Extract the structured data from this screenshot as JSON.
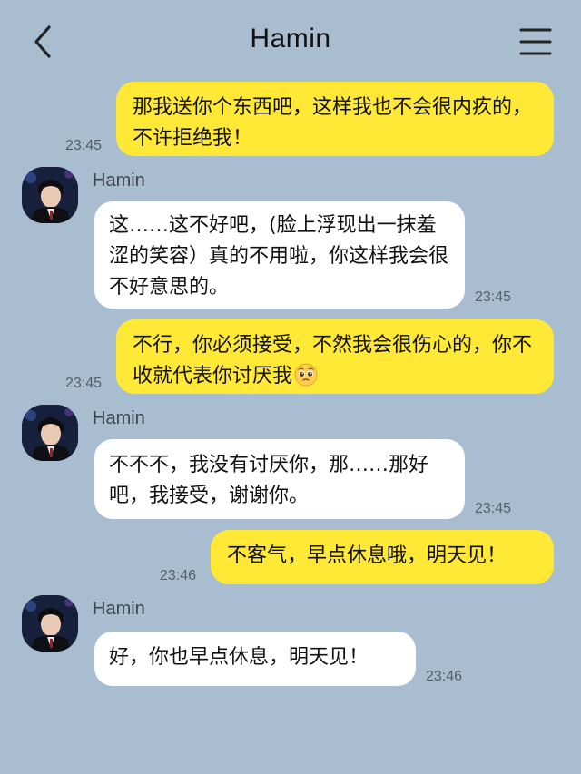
{
  "header": {
    "title": "Hamin",
    "back_icon": "chevron-left-icon",
    "menu_icon": "hamburger-menu-icon"
  },
  "colors": {
    "background": "#a9bdd0",
    "my_bubble": "#ffe936",
    "their_bubble": "#ffffff"
  },
  "messages": [
    {
      "sender": "me",
      "text": "那我送你个东西吧，这样我也不会很内疚的，不许拒绝我！",
      "time": "23:45"
    },
    {
      "sender": "Hamin",
      "name": "Hamin",
      "text": "这……这不好吧，(脸上浮现出一抹羞涩的笑容）真的不用啦，你这样我会很不好意思的。",
      "time": "23:45"
    },
    {
      "sender": "me",
      "text": "不行，你必须接受，不然我会很伤心的，你不收就代表你讨厌我",
      "emoji": "pleading-face-emoji",
      "time": "23:45"
    },
    {
      "sender": "Hamin",
      "name": "Hamin",
      "text": "不不不，我没有讨厌你，那……那好吧，我接受，谢谢你。",
      "time": "23:45"
    },
    {
      "sender": "me",
      "text": "不客气，早点休息哦，明天见！",
      "time": "23:46"
    },
    {
      "sender": "Hamin",
      "name": "Hamin",
      "text": "好，你也早点休息，明天见！",
      "time": "23:46"
    }
  ]
}
